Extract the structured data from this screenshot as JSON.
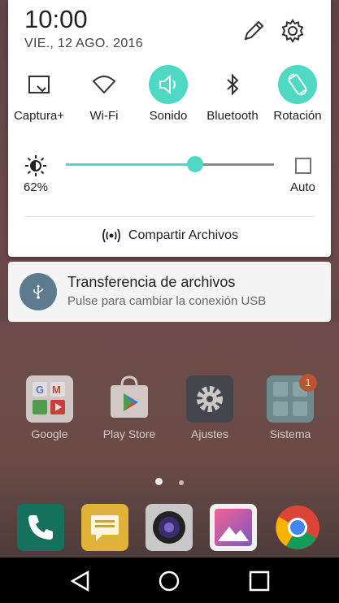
{
  "status_panel": {
    "time": "10:00",
    "date": "VIE., 12 AGO. 2016"
  },
  "quick_tiles": [
    {
      "label": "Captura+",
      "icon": "capture-plus-icon",
      "active": false
    },
    {
      "label": "Wi-Fi",
      "icon": "wifi-icon",
      "active": false
    },
    {
      "label": "Sonido",
      "icon": "sound-icon",
      "active": true
    },
    {
      "label": "Bluetooth",
      "icon": "bluetooth-icon",
      "active": false
    },
    {
      "label": "Rotación",
      "icon": "rotation-icon",
      "active": true
    }
  ],
  "brightness": {
    "percent_label": "62%",
    "level": 0.62,
    "auto_label": "Auto",
    "auto_checked": false
  },
  "share": {
    "label": "Compartir Archivos"
  },
  "notification": {
    "title": "Transferencia de archivos",
    "text": "Pulse para cambiar la conexión USB",
    "icon": "usb-icon"
  },
  "home_apps": [
    {
      "label": "Google",
      "icon": "google-folder-icon"
    },
    {
      "label": "Play Store",
      "icon": "play-store-icon"
    },
    {
      "label": "Ajustes",
      "icon": "settings-app-icon"
    },
    {
      "label": "Sistema",
      "icon": "system-folder-icon",
      "badge": "1"
    }
  ],
  "dock_apps": [
    "phone-icon",
    "messages-icon",
    "camera-icon",
    "gallery-icon",
    "chrome-icon"
  ],
  "page_indicator": {
    "pages": 2,
    "current": 1
  },
  "nav": [
    "back-button",
    "home-button",
    "recents-button"
  ],
  "colors": {
    "accent": "#4fd8c3",
    "notif_icon_bg": "#5d7a8f"
  }
}
